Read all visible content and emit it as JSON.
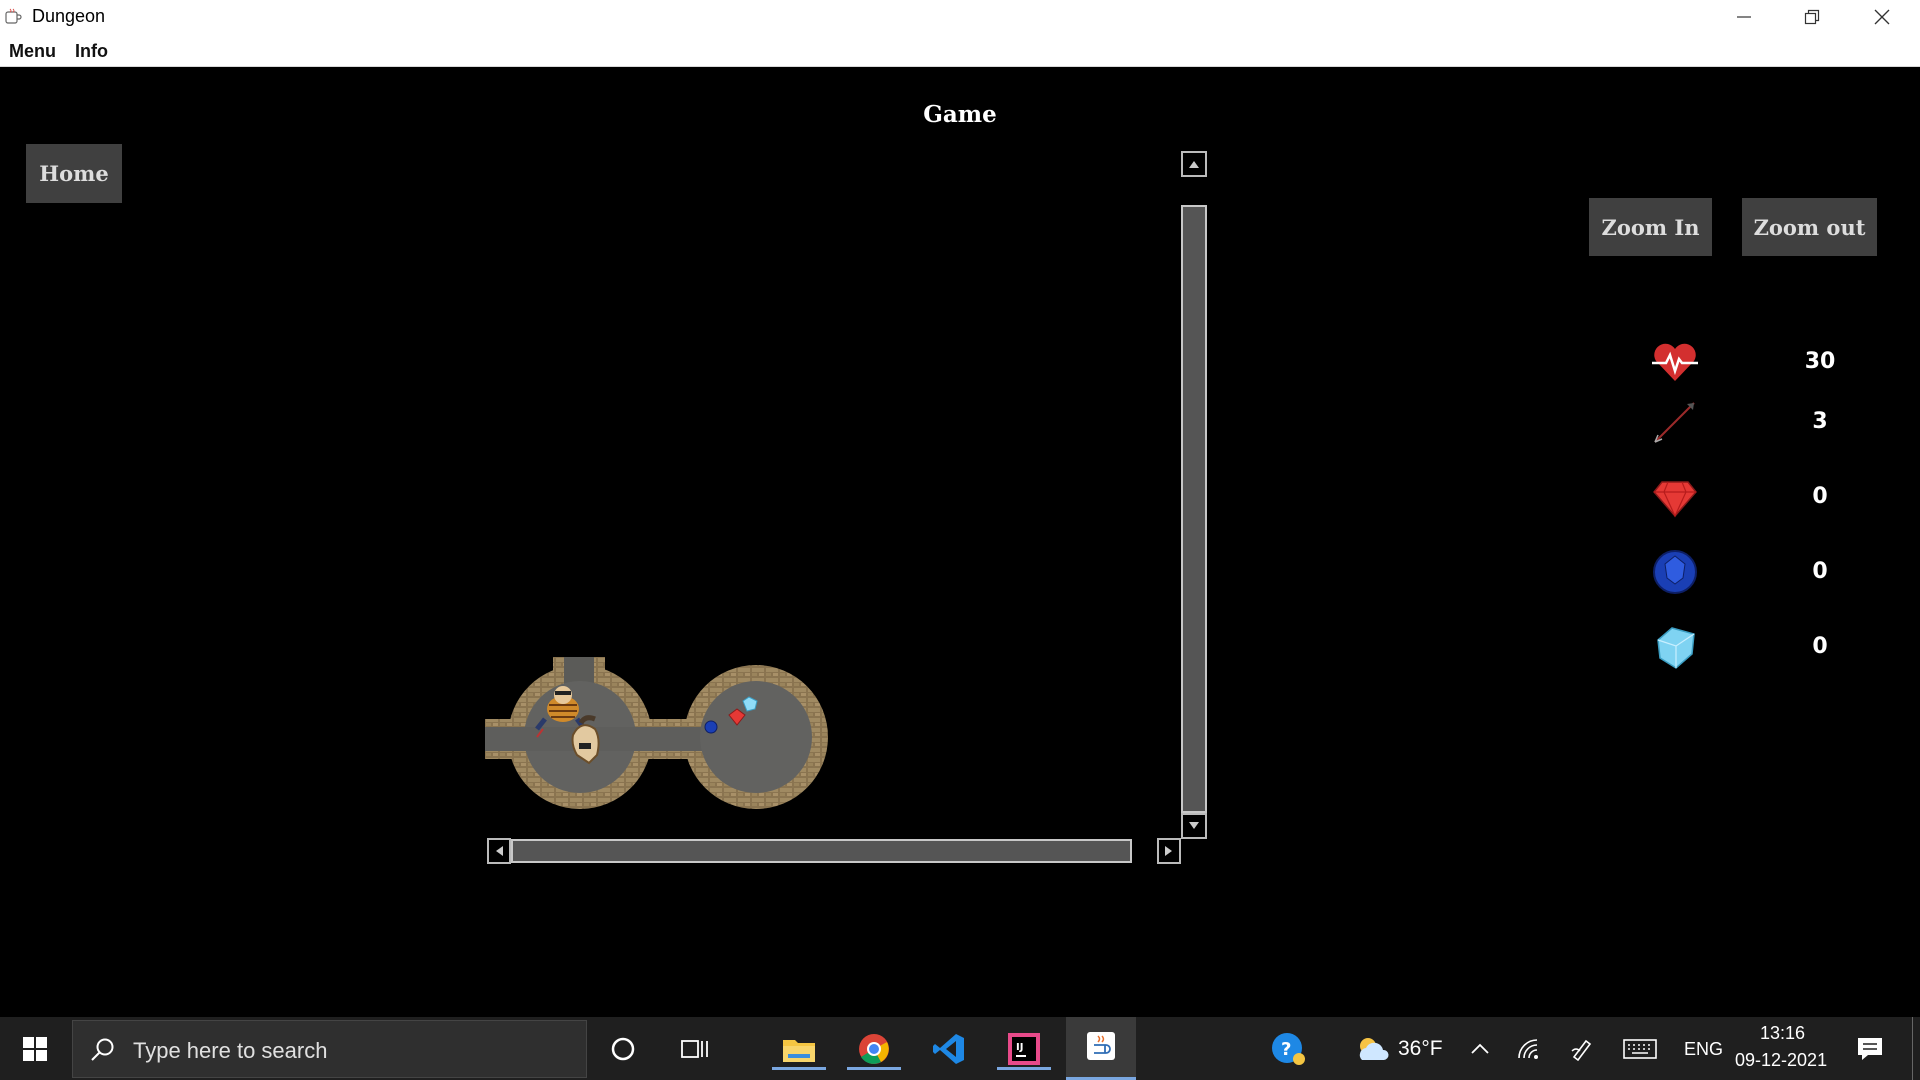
{
  "window": {
    "title": "Dungeon",
    "menus": [
      "Menu",
      "Info"
    ]
  },
  "game": {
    "title": "Game",
    "home_label": "Home",
    "zoom_in_label": "Zoom In",
    "zoom_out_label": "Zoom out"
  },
  "stats": [
    {
      "name": "health",
      "icon": "heart-icon",
      "value": "30"
    },
    {
      "name": "arrows",
      "icon": "arrow-icon",
      "value": "3"
    },
    {
      "name": "rubies",
      "icon": "ruby-icon",
      "value": "0"
    },
    {
      "name": "sapphires",
      "icon": "sapphire-icon",
      "value": "0"
    },
    {
      "name": "diamonds",
      "icon": "diamond-icon",
      "value": "0"
    }
  ],
  "taskbar": {
    "search_placeholder": "Type here to search",
    "weather": "36°F",
    "language": "ENG",
    "time": "13:16",
    "date": "09-12-2021"
  },
  "colors": {
    "background": "#000000",
    "button_bg": "#404040",
    "heart": "#d32f2f",
    "ruby": "#e53935",
    "sapphire": "#1a3fb5",
    "diamond": "#7fd3f2"
  }
}
